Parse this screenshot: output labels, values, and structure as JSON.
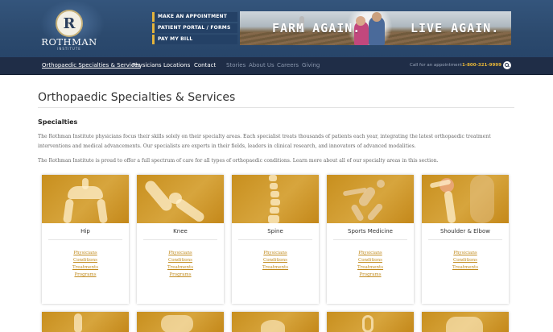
{
  "header": {
    "logo_letter": "R",
    "logo_name": "ROTHMAN",
    "logo_sub": "INSTITUTE",
    "quick_links": [
      "MAKE AN APPOINTMENT",
      "PATIENT PORTAL / FORMS",
      "PAY MY BILL"
    ],
    "banner": {
      "left": "FARM AGAIN.",
      "right": "LIVE AGAIN."
    }
  },
  "nav": {
    "primary": [
      "Orthopaedic Specialties & Services",
      "Physicians",
      "Locations",
      "Contact"
    ],
    "secondary": [
      "Stories",
      "About Us",
      "Careers",
      "Giving"
    ],
    "appointment_label": "Call for an appointment",
    "phone": "1-800-321-9999",
    "search_icon": "search-icon"
  },
  "main": {
    "title": "Orthopaedic Specialties & Services",
    "section_title": "Specialties",
    "paragraph1": "The Rothman Institute physicians focus their skills solely on their specialty areas. Each specialist treats thousands of patients each year, integrating the latest orthopaedic treatment interventions and medical advancements. Our specialists are experts in their fields, leaders in clinical research, and innovators of advanced modalities.",
    "paragraph2": "The Rothman Institute is proud to offer a full spectrum of care for all types of orthopaedic conditions. Learn more about all of our specialty areas in this section."
  },
  "cards": [
    {
      "name": "Hip",
      "links": [
        "Physicians",
        "Conditions",
        "Treatments",
        "Programs"
      ]
    },
    {
      "name": "Knee",
      "links": [
        "Physicians",
        "Conditions",
        "Treatments",
        "Programs"
      ]
    },
    {
      "name": "Spine",
      "links": [
        "Physicians",
        "Conditions",
        "Treatments"
      ]
    },
    {
      "name": "Sports Medicine",
      "links": [
        "Physicians",
        "Conditions",
        "Treatments",
        "Programs"
      ]
    },
    {
      "name": "Shoulder & Elbow",
      "links": [
        "Physicians",
        "Conditions",
        "Treatments"
      ]
    }
  ],
  "colors": {
    "header": "#2c4a6e",
    "navbar": "#1f2d47",
    "accent": "#e9b737",
    "card_image": "#d09a30",
    "link": "#c08a1c"
  }
}
